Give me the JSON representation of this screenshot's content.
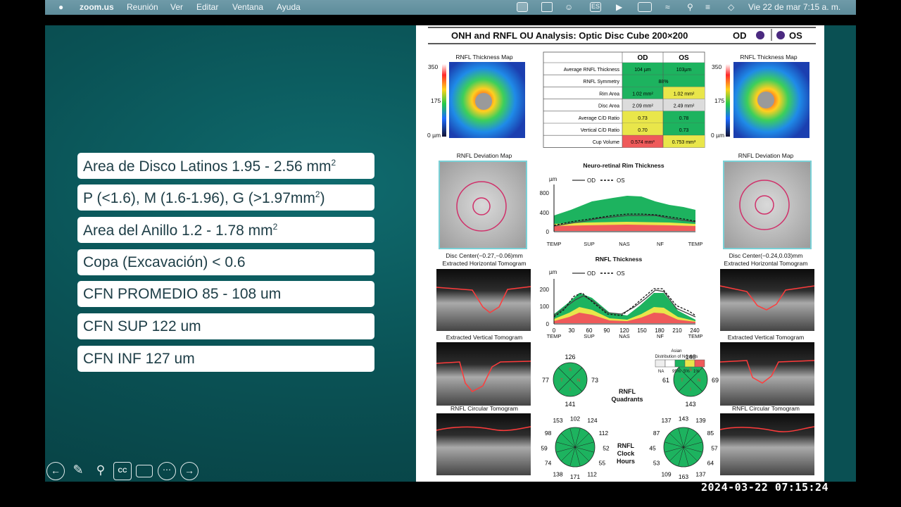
{
  "menubar": {
    "apple": "",
    "app": "zoom.us",
    "items": [
      "Reunión",
      "Ver",
      "Editar",
      "Ventana",
      "Ayuda"
    ],
    "lang": "ES",
    "clock": "Vie 22 de mar  7:15 a. m."
  },
  "slide": {
    "pills": [
      {
        "text": "Area de Disco Latinos 1.95 - 2.56 mm",
        "sup": "2"
      },
      {
        "text": "P (<1.6), M (1.6-1.96), G (>1.97mm",
        "sup": "2",
        "tail": ")"
      },
      {
        "text": "Area del Anillo  1.2 - 1.78 mm",
        "sup": "2"
      },
      {
        "text": "Copa (Excavación) < 0.6",
        "sup": ""
      },
      {
        "text": "CFN PROMEDIO 85 - 108 um",
        "sup": ""
      },
      {
        "text": "CFN SUP 122 um",
        "sup": ""
      },
      {
        "text": "CFN INF 127 um",
        "sup": ""
      }
    ]
  },
  "report": {
    "title": "ONH and RNFL OU Analysis: Optic Disc Cube 200×200",
    "od": "OD",
    "os": "OS",
    "thickness_map_title": "RNFL Thickness Map",
    "scale": [
      "350",
      "175",
      "0 µm"
    ],
    "table": {
      "headers": [
        "",
        "OD",
        "OS"
      ],
      "rows": [
        {
          "label": "Average RNFL Thickness",
          "od": "104 µm",
          "os": "103µm"
        },
        {
          "label": "RNFL Symmetry",
          "both": "88%"
        },
        {
          "label": "Rim Area",
          "od": "1.02 mm²",
          "os": "1.02 mm²"
        },
        {
          "label": "Disc Area",
          "od": "2.09 mm²",
          "os": "2.49 mm²"
        },
        {
          "label": "Average C/D Ratio",
          "od": "0.73",
          "os": "0.78"
        },
        {
          "label": "Vertical C/D Ratio",
          "od": "0.70",
          "os": "0.73"
        },
        {
          "label": "Cup Volume",
          "od": "0.574 mm³",
          "os": "0.753 mm³"
        }
      ]
    },
    "deviation_title": "RNFL Deviation Map",
    "rim_chart_title": "Neuro-retinal Rim Thickness",
    "thick_chart_title": "RNFL Thickness",
    "legend_od": "OD",
    "legend_os": "OS",
    "unit": "µm",
    "rim_yticks": [
      "800",
      "400",
      "0"
    ],
    "rim_xticks": [
      "TEMP",
      "SUP",
      "NAS",
      "NF",
      "TEMP"
    ],
    "thick_yticks": [
      "200",
      "100",
      "0"
    ],
    "thick_xnums": [
      "0",
      "30",
      "60",
      "90",
      "120",
      "150",
      "180",
      "210",
      "240"
    ],
    "thick_xwords": [
      "TEMP",
      "SUP",
      "NAS",
      "NF",
      "TEMP"
    ],
    "disc_center_od": "Disc Center(−0.27,−0.06)mm",
    "disc_center_os": "Disc Center(−0.24,0.03)mm",
    "horiz_tomo": "Extracted Horizontal Tomogram",
    "vert_tomo": "Extracted Vertical Tomogram",
    "circ_tomo": "RNFL Circular Tomogram",
    "norms_title_1": "Asian",
    "norms_title_2": "Distribution of Normals",
    "norms_labels": [
      "NA",
      "95%",
      "5%",
      "1%"
    ],
    "quadrants_label_1": "RNFL",
    "quadrants_label_2": "Quadrants",
    "quad_od": {
      "top": "126",
      "left": "77",
      "right": "73",
      "bottom": "141"
    },
    "quad_os": {
      "top": "140",
      "left": "61",
      "right": "69",
      "bottom": "143"
    },
    "quad_letters": [
      "S",
      "N",
      "I",
      "T"
    ],
    "clock_label_1": "RNFL",
    "clock_label_2": "Clock",
    "clock_label_3": "Hours",
    "clock_od": [
      "153",
      "102",
      "124",
      "98",
      "112",
      "59",
      "52",
      "74",
      "55",
      "138",
      "171",
      "112"
    ],
    "clock_os": [
      "137",
      "143",
      "139",
      "87",
      "85",
      "45",
      "57",
      "53",
      "64",
      "109",
      "163",
      "137"
    ]
  },
  "colors": {
    "green": "#1db35f",
    "yellow": "#e9e64a",
    "red": "#ef5a5a",
    "od_dot": "#4b2a80"
  },
  "controls": [
    "back-icon",
    "pen-icon",
    "zoom-icon",
    "cc-icon",
    "camera-icon",
    "more-icon",
    "next-icon"
  ],
  "cc_label": "CC",
  "timestamp": "2024-03-22  07:15:24"
}
